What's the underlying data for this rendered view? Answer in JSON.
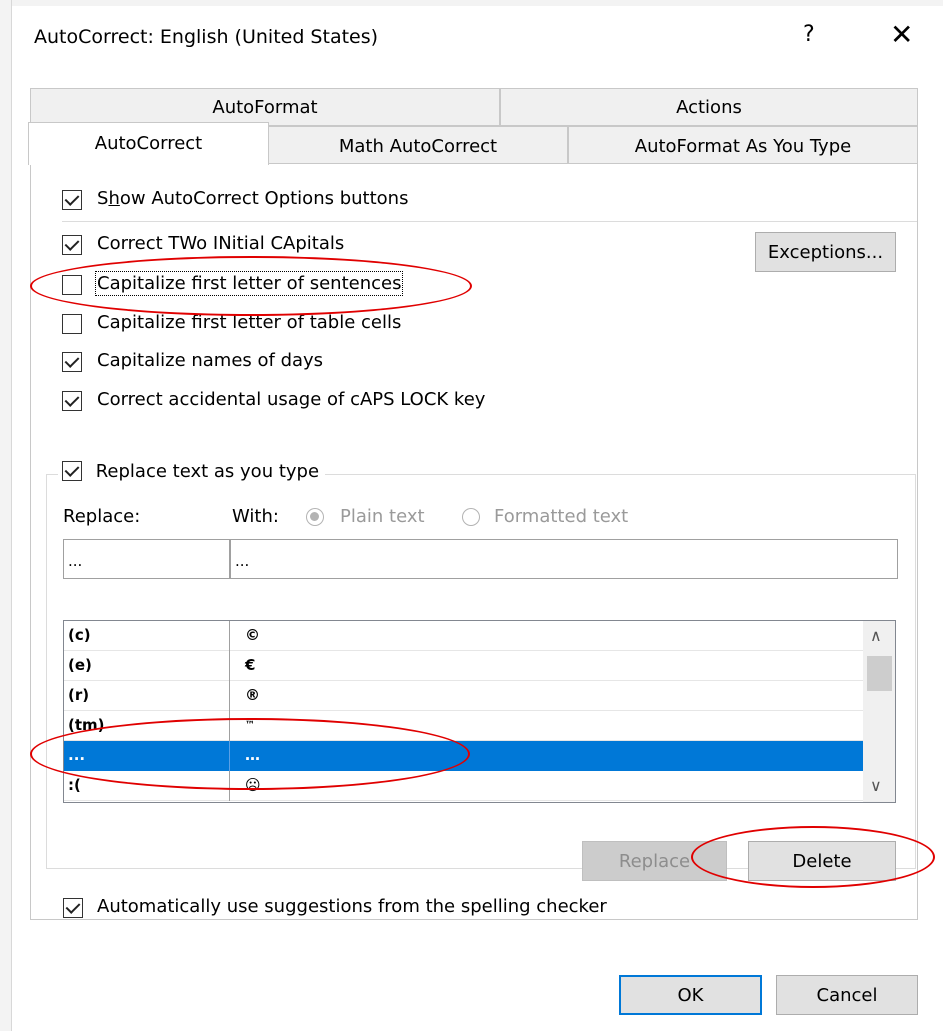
{
  "window": {
    "title": "AutoCorrect: English (United States)",
    "help_glyph": "?",
    "close_glyph": "✕"
  },
  "tabs": {
    "row_back": [
      "AutoFormat",
      "Actions"
    ],
    "row_front": [
      "AutoCorrect",
      "Math AutoCorrect",
      "AutoFormat As You Type"
    ],
    "active": "AutoCorrect"
  },
  "options": {
    "show_buttons": {
      "label": "Show AutoCorrect Options buttons",
      "checked": true
    },
    "two_initial": {
      "label": "Correct TWo INitial CApitals",
      "checked": true
    },
    "first_letter_sentences": {
      "label": "Capitalize first letter of sentences",
      "checked": false
    },
    "first_letter_cells": {
      "label": "Capitalize first letter of table cells",
      "checked": false
    },
    "names_of_days": {
      "label": "Capitalize names of days",
      "checked": true
    },
    "caps_lock": {
      "label": "Correct accidental usage of cAPS LOCK key",
      "checked": true
    },
    "exceptions_button": "Exceptions..."
  },
  "replace_group": {
    "replace_text_label": "Replace text as you type",
    "replace_text_checked": true,
    "replace_label": "Replace:",
    "with_label": "With:",
    "plain_text": "Plain text",
    "formatted_text": "Formatted text",
    "selected_format": "Plain text",
    "replace_value": "...",
    "with_value": "...",
    "entries": [
      {
        "replace": "(c)",
        "with": "©",
        "selected": false
      },
      {
        "replace": "(e)",
        "with": "€",
        "selected": false
      },
      {
        "replace": "(r)",
        "with": "®",
        "selected": false
      },
      {
        "replace": "(tm)",
        "with": "™",
        "selected": false
      },
      {
        "replace": "...",
        "with": "…",
        "selected": true
      },
      {
        "replace": ":(",
        "with": "☹",
        "selected": false
      }
    ],
    "replace_button": "Replace",
    "delete_button": "Delete",
    "spelling_label": "Automatically use suggestions from the spelling checker",
    "spelling_checked": true
  },
  "footer": {
    "ok": "OK",
    "cancel": "Cancel"
  },
  "annotations": {
    "color": "#e00000"
  }
}
